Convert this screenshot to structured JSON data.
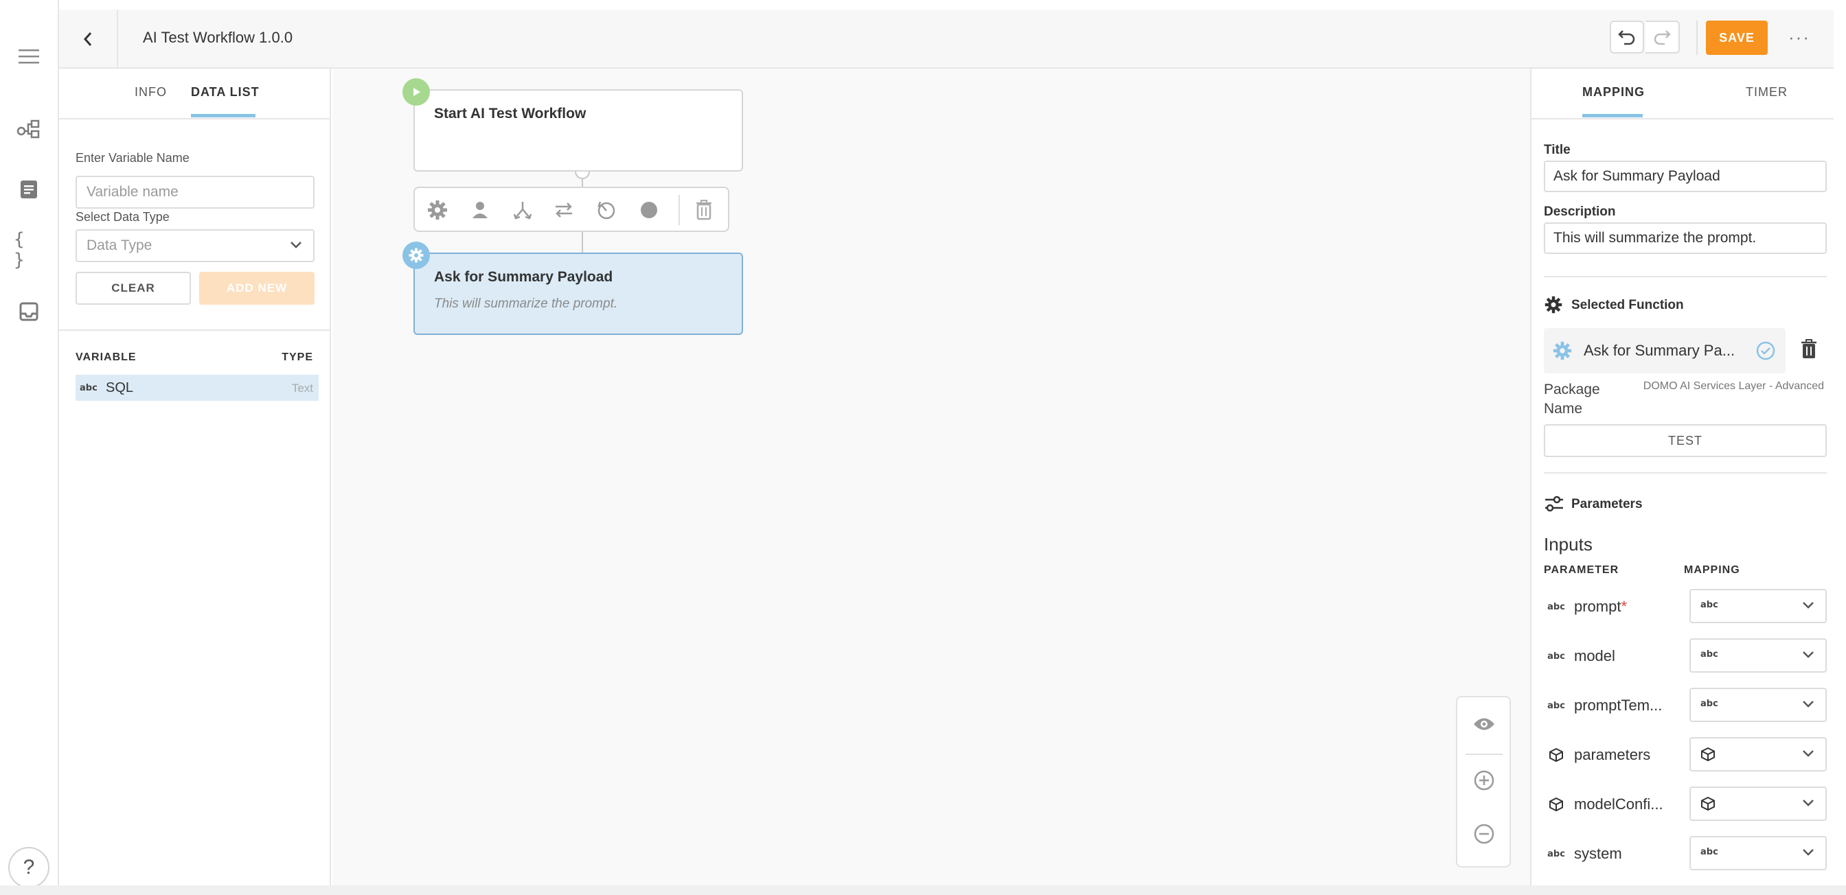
{
  "header": {
    "title": "AI Test Workflow 1.0.0",
    "save_label": "SAVE",
    "more_label": "···"
  },
  "left_panel": {
    "tabs": [
      {
        "label": "INFO",
        "active": false
      },
      {
        "label": "DATA LIST",
        "active": true
      }
    ],
    "variable_name_label": "Enter Variable Name",
    "variable_name_placeholder": "Variable name",
    "data_type_label": "Select Data Type",
    "data_type_value": "Data Type",
    "clear_label": "CLEAR",
    "add_new_label": "ADD NEW",
    "table": {
      "col_variable": "VARIABLE",
      "col_type": "TYPE",
      "rows": [
        {
          "icon": "abc",
          "name": "SQL",
          "type": "Text"
        }
      ]
    }
  },
  "canvas": {
    "start_node": {
      "title": "Start AI Test Workflow"
    },
    "selected_node": {
      "title": "Ask for Summary Payload",
      "description": "This will summarize the prompt."
    }
  },
  "right_panel": {
    "tabs": [
      {
        "label": "MAPPING",
        "active": true
      },
      {
        "label": "TIMER",
        "active": false
      }
    ],
    "title_label": "Title",
    "title_value": "Ask for Summary Payload",
    "description_label": "Description",
    "description_value": "This will summarize the prompt.",
    "selected_function_label": "Selected Function",
    "function_name": "Ask for Summary Pa...",
    "package_name_label": "Package Name",
    "package_name_value": "DOMO AI Services Layer - Advanced",
    "test_label": "TEST",
    "parameters_label": "Parameters",
    "inputs_label": "Inputs",
    "col_parameter": "PARAMETER",
    "col_mapping": "MAPPING",
    "params": [
      {
        "name": "prompt",
        "required": true,
        "type": "text"
      },
      {
        "name": "model",
        "required": false,
        "type": "text"
      },
      {
        "name": "promptTem...",
        "required": false,
        "type": "text"
      },
      {
        "name": "parameters",
        "required": false,
        "type": "object"
      },
      {
        "name": "modelConfi...",
        "required": false,
        "type": "object"
      },
      {
        "name": "system",
        "required": false,
        "type": "text"
      }
    ],
    "abc_glyph": "abc",
    "required_mark": "*"
  },
  "colors": {
    "accent_orange": "#f7931e",
    "start_green": "#8cd17d",
    "selected_blue": "#dcebf6",
    "badge_blue": "#8ac3e6"
  },
  "help_label": "?"
}
